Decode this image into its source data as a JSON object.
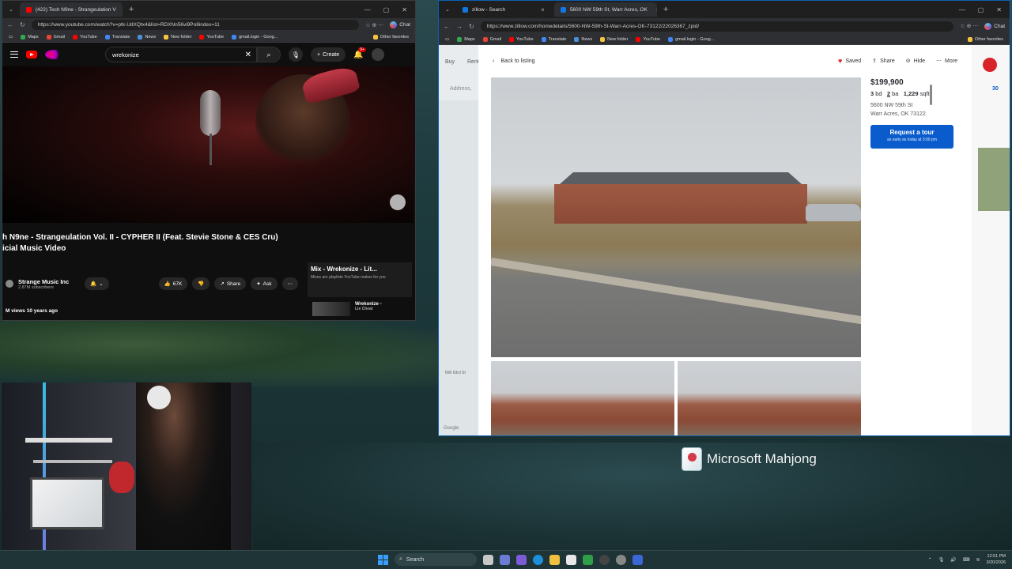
{
  "left_browser": {
    "tab_title": "(422) Tech N9ne - Strangeulation V",
    "url": "https://www.youtube.com/watch?v=ptk-UdXQtx4&list=RDXNn56vi9Po8index=11",
    "chat_label": "Chat",
    "bookmarks": [
      "Maps",
      "Gmail",
      "YouTube",
      "Translate",
      "News",
      "New folder",
      "YouTube",
      "gmail.login - Goog..."
    ],
    "other_favorites": "Other favorites"
  },
  "youtube": {
    "search_value": "wrekonize",
    "create_label": "Create",
    "notif_count": "9+",
    "video_title_line1": "h N9ne - Strangeulation Vol. II - CYPHER II (Feat. Stevie Stone & CES Cru)",
    "video_title_line2": "icial Music Video",
    "channel_name": "Strange Music Inc",
    "subscribers": "2.87M subscribers",
    "likes": "67K",
    "share_label": "Share",
    "ask_label": "Ask",
    "views": "M views  10 years ago",
    "mix_title": "Mix - Wrekonize - Lit...",
    "mix_sub": "Mixes are playlists YouTube makes for you",
    "rec_title_1": "Wrekonize -",
    "rec_title_2": "Lie Cheat"
  },
  "right_browser": {
    "tab1_title": "zillow - Search",
    "tab2_title": "5600 NW 59th St, Warr Acres, OK",
    "url": "https://www.zillow.com/homedetails/5600-NW-59th-St-Warr-Acres-OK-73122/22026367_zpid/",
    "chat_label": "Chat",
    "bookmarks": [
      "Maps",
      "Gmail",
      "YouTube",
      "Translate",
      "News",
      "New folder",
      "YouTube",
      "gmail.login - Goog..."
    ],
    "other_favorites": "Other favorites"
  },
  "zillow": {
    "buy": "Buy",
    "rent": "Rent",
    "address_placeholder": "Address,",
    "back_label": "Back to listing",
    "saved_label": "Saved",
    "share_label": "Share",
    "hide_label": "Hide",
    "more_label": "More",
    "price": "$199,900",
    "beds_num": "3",
    "beds_lbl": "bd",
    "baths_num": "2",
    "baths_lbl": "ba",
    "sqft_num": "1,229",
    "sqft_lbl": "sqft",
    "address_line1": "5600 NW 59th St",
    "address_line2": "Warr Acres, OK 73122",
    "tour_button": "Request a tour",
    "tour_sub": "as early as today at 3:00 pm",
    "map_label": "NW 63rd St",
    "google_label": "Google",
    "right_count": "30"
  },
  "desktop": {
    "mahjong_label": "Microsoft Mahjong"
  },
  "taskbar": {
    "search_label": "Search",
    "time": "12:51 PM",
    "date": "3/20/2026"
  }
}
